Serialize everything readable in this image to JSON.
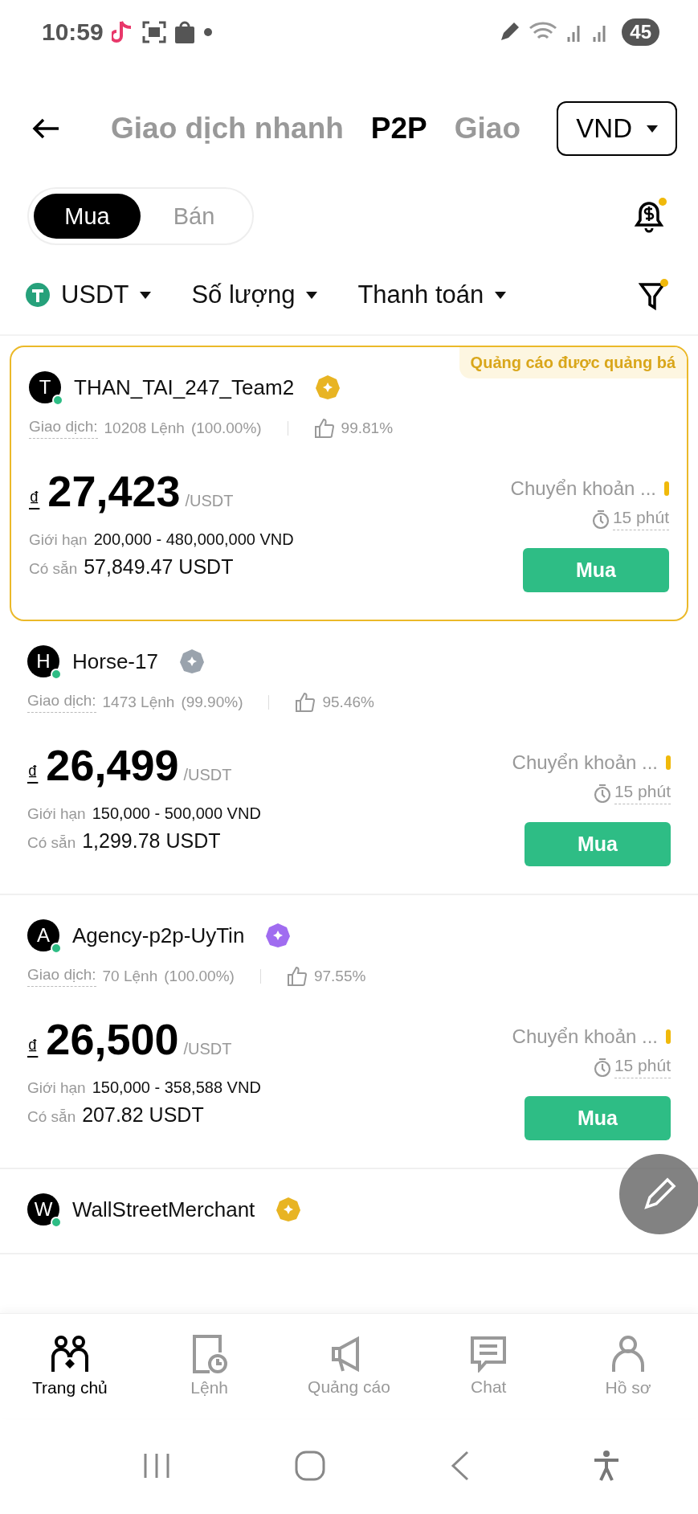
{
  "status_bar": {
    "time": "10:59",
    "battery": "45"
  },
  "header": {
    "tabs": [
      {
        "label": "Giao dịch nhanh",
        "selected": false
      },
      {
        "label": "P2P",
        "selected": true
      },
      {
        "label": "Giao",
        "selected": false
      }
    ],
    "currency": "VND"
  },
  "side_toggle": [
    {
      "label": "Mua",
      "selected": true
    },
    {
      "label": "Bán",
      "selected": false
    }
  ],
  "filters": [
    {
      "label": "USDT",
      "kind": "coin"
    },
    {
      "label": "Số lượng",
      "kind": "plain"
    },
    {
      "label": "Thanh toán",
      "kind": "plain"
    }
  ],
  "ads": [
    {
      "avatar": "T",
      "name": "THAN_TAI_247_Team2",
      "color": "#e8b423",
      "promoted": true,
      "promo_label": "Quảng cáo được quảng bá",
      "trades_label": "Giao dịch:",
      "orders": "10208 Lệnh",
      "completion": "(100.00%)",
      "rating": "99.81%",
      "currency_sign": "₫",
      "price": "27,423",
      "unit": "/USDT",
      "payment": "Chuyển khoản ...",
      "time": "15 phút",
      "limit_label": "Giới hạn",
      "limit": "200,000 - 480,000,000 VND",
      "available_label": "Có sẵn",
      "available": "57,849.47 USDT",
      "action": "Mua"
    },
    {
      "avatar": "H",
      "name": "Horse-17",
      "color": "#9aa3ad",
      "promoted": false,
      "trades_label": "Giao dịch:",
      "orders": "1473 Lệnh",
      "completion": "(99.90%)",
      "rating": "95.46%",
      "currency_sign": "₫",
      "price": "26,499",
      "unit": "/USDT",
      "payment": "Chuyển khoản ...",
      "time": "15 phút",
      "limit_label": "Giới hạn",
      "limit": "150,000 - 500,000 VND",
      "available_label": "Có sẵn",
      "available": "1,299.78 USDT",
      "action": "Mua"
    },
    {
      "avatar": "A",
      "name": "Agency-p2p-UyTin",
      "color": "#a06cf0",
      "promoted": false,
      "trades_label": "Giao dịch:",
      "orders": "70 Lệnh",
      "completion": "(100.00%)",
      "rating": "97.55%",
      "currency_sign": "₫",
      "price": "26,500",
      "unit": "/USDT",
      "payment": "Chuyển khoản ...",
      "time": "15 phút",
      "limit_label": "Giới hạn",
      "limit": "150,000 - 358,588 VND",
      "available_label": "Có sẵn",
      "available": "207.82 USDT",
      "action": "Mua"
    },
    {
      "avatar": "W",
      "name": "WallStreetMerchant",
      "color": "#e8b423",
      "promoted": false
    }
  ],
  "bottom_nav": [
    {
      "label": "Trang chủ",
      "kind": "home",
      "selected": true
    },
    {
      "label": "Lệnh",
      "kind": "orders",
      "selected": false
    },
    {
      "label": "Quảng cáo",
      "kind": "ads",
      "selected": false
    },
    {
      "label": "Chat",
      "kind": "chat",
      "selected": false
    },
    {
      "label": "Hồ sơ",
      "kind": "profile",
      "selected": false
    }
  ]
}
